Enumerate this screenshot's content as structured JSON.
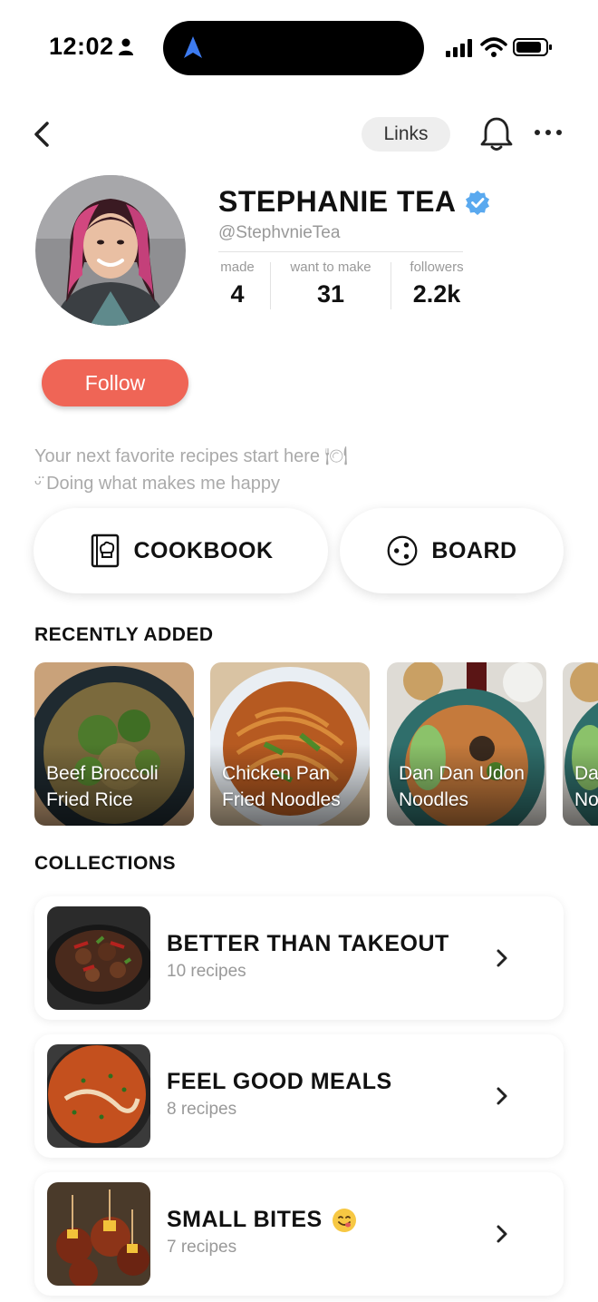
{
  "status_bar": {
    "time": "12:02"
  },
  "nav": {
    "links_label": "Links"
  },
  "profile": {
    "name": "STEPHANIE TEA",
    "handle": "@StephvnieTea",
    "stats": [
      {
        "label": "made",
        "value": "4"
      },
      {
        "label": "want to make",
        "value": "31"
      },
      {
        "label": "followers",
        "value": "2.2k"
      }
    ],
    "follow_label": "Follow",
    "bio": [
      "Your next favorite recipes start here 🍽",
      "ᵕ̈ Doing what makes me happy"
    ]
  },
  "buttons": {
    "cookbook": "COOKBOOK",
    "board": "BOARD"
  },
  "recently_added": {
    "title": "RECENTLY ADDED",
    "items": [
      {
        "line1": "Beef Broccoli",
        "line2": "Fried Rice"
      },
      {
        "line1": "Chicken Pan",
        "line2": "Fried Noodles"
      },
      {
        "line1": "Dan Dan Udon",
        "line2": "Noodles"
      },
      {
        "line1": "Da",
        "line2": "No"
      }
    ]
  },
  "collections": {
    "title": "COLLECTIONS",
    "items": [
      {
        "title": "BETTER THAN TAKEOUT",
        "count": "10 recipes"
      },
      {
        "title": "FEEL GOOD MEALS",
        "count": "8 recipes"
      },
      {
        "title": "SMALL BITES",
        "count": "7 recipes"
      }
    ]
  },
  "colors": {
    "accent": "#ef6556",
    "verified": "#5aa9ef",
    "text_muted": "#999999"
  }
}
